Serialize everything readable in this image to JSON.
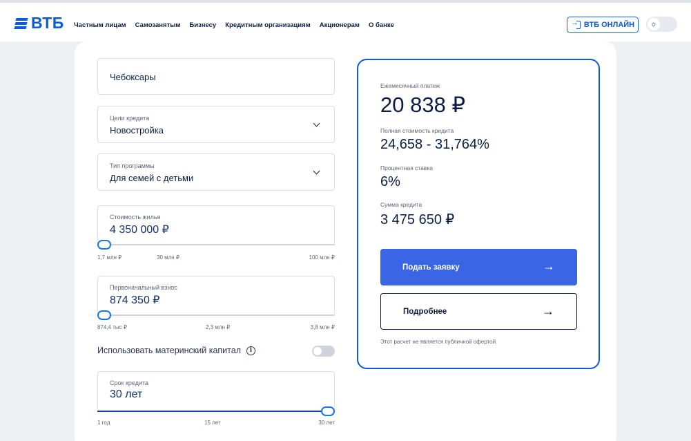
{
  "header": {
    "logo_text": "ВТБ",
    "nav": [
      "Частным лицам",
      "Самозанятым",
      "Бизнесу",
      "Кредитным организациям",
      "Акционерам",
      "О банке"
    ],
    "online_button": "ВТБ ОНЛАЙН"
  },
  "form": {
    "city": "Чебоксары",
    "purpose": {
      "label": "Цели кредита",
      "value": "Новостройка"
    },
    "program": {
      "label": "Тип программы",
      "value": "Для семей с детьми"
    },
    "property_cost": {
      "label": "Стоимость жилья",
      "value": "4 350 000 ₽",
      "ticks": [
        "1,7 млн ₽",
        "30 млн ₽",
        "100 млн ₽"
      ],
      "slider_fraction": 0.0
    },
    "down_payment": {
      "label": "Первоначальный взнос",
      "value": "874 350 ₽",
      "ticks": [
        "874,4 тыс ₽",
        "2,3 млн ₽",
        "3,8 млн ₽"
      ],
      "slider_fraction": 0.0
    },
    "maternity_capital": {
      "label": "Использовать материнский капитал",
      "info_icon": "info-icon",
      "enabled": false
    },
    "term": {
      "label": "Срок кредита",
      "value": "30 лет",
      "ticks": [
        "1 год",
        "15 лет",
        "30 лет"
      ],
      "slider_fraction": 1.0
    }
  },
  "result": {
    "monthly_payment": {
      "label": "Ежемесячный платеж",
      "value": "20 838 ₽"
    },
    "full_cost": {
      "label": "Полная стоимость кредита",
      "value": "24,658 - 31,764%"
    },
    "rate": {
      "label": "Процентная ставка",
      "value": "6%"
    },
    "loan_amount": {
      "label": "Сумма кредита",
      "value": "3 475 650 ₽"
    },
    "apply_button": "Подать заявку",
    "details_button": "Подробнее",
    "disclaimer": "Этот расчет не является публичной офертой"
  },
  "colors": {
    "accent": "#0a5dd6",
    "primary_button": "#3a66e6",
    "text": "#0a1e44"
  }
}
